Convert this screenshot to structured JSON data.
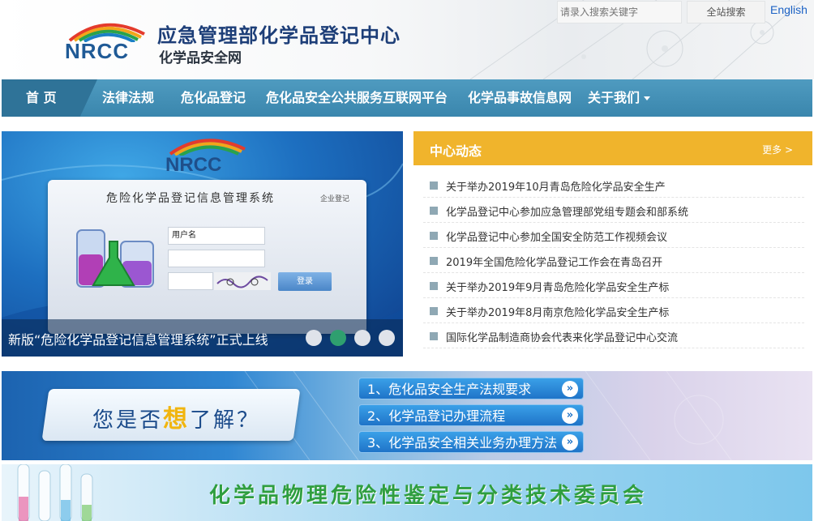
{
  "header": {
    "logo_text": "NRCC",
    "title": "应急管理部化学品登记中心",
    "subtitle": "化学品安全网",
    "search_placeholder": "请录入搜索关键字",
    "search_button": "全站搜索",
    "english_link": "English"
  },
  "nav": {
    "items": [
      {
        "label": "首 页"
      },
      {
        "label": "法律法规"
      },
      {
        "label": "危化品登记"
      },
      {
        "label": "危化品安全公共服务互联网平台"
      },
      {
        "label": "化学品事故信息网"
      },
      {
        "label": "关于我们"
      }
    ]
  },
  "slider": {
    "logo_text": "NRCC",
    "panel_title": "危险化学品登记信息管理系统",
    "panel_link": "企业登记",
    "username_label": "用户名",
    "login_button": "登录",
    "caption": "新版“危险化学品登记信息管理系统”正式上线",
    "active_dot": 2
  },
  "news": {
    "title": "中心动态",
    "more": "更多 >",
    "items": [
      "关于举办2019年10月青岛危险化学品安全生产",
      "化学品登记中心参加应急管理部党组专题会和部系统",
      "化学品登记中心参加全国安全防范工作视频会议",
      "2019年全国危险化学品登记工作会在青岛召开",
      "关于举办2019年9月青岛危险化学品安全生产标",
      "关于举办2019年8月南京危险化学品安全生产标",
      "国际化学品制造商协会代表来化学品登记中心交流"
    ]
  },
  "banner1": {
    "question_pre": "您是否",
    "question_hl": "想",
    "question_post": "了解？",
    "buttons": [
      "1、危化品安全生产法规要求",
      "2、化学品登记办理流程",
      "3、化学品安全相关业务办理方法"
    ],
    "arrow_glyph": "»"
  },
  "banner2": {
    "text": "化学品物理危险性鉴定与分类技术委员会"
  }
}
